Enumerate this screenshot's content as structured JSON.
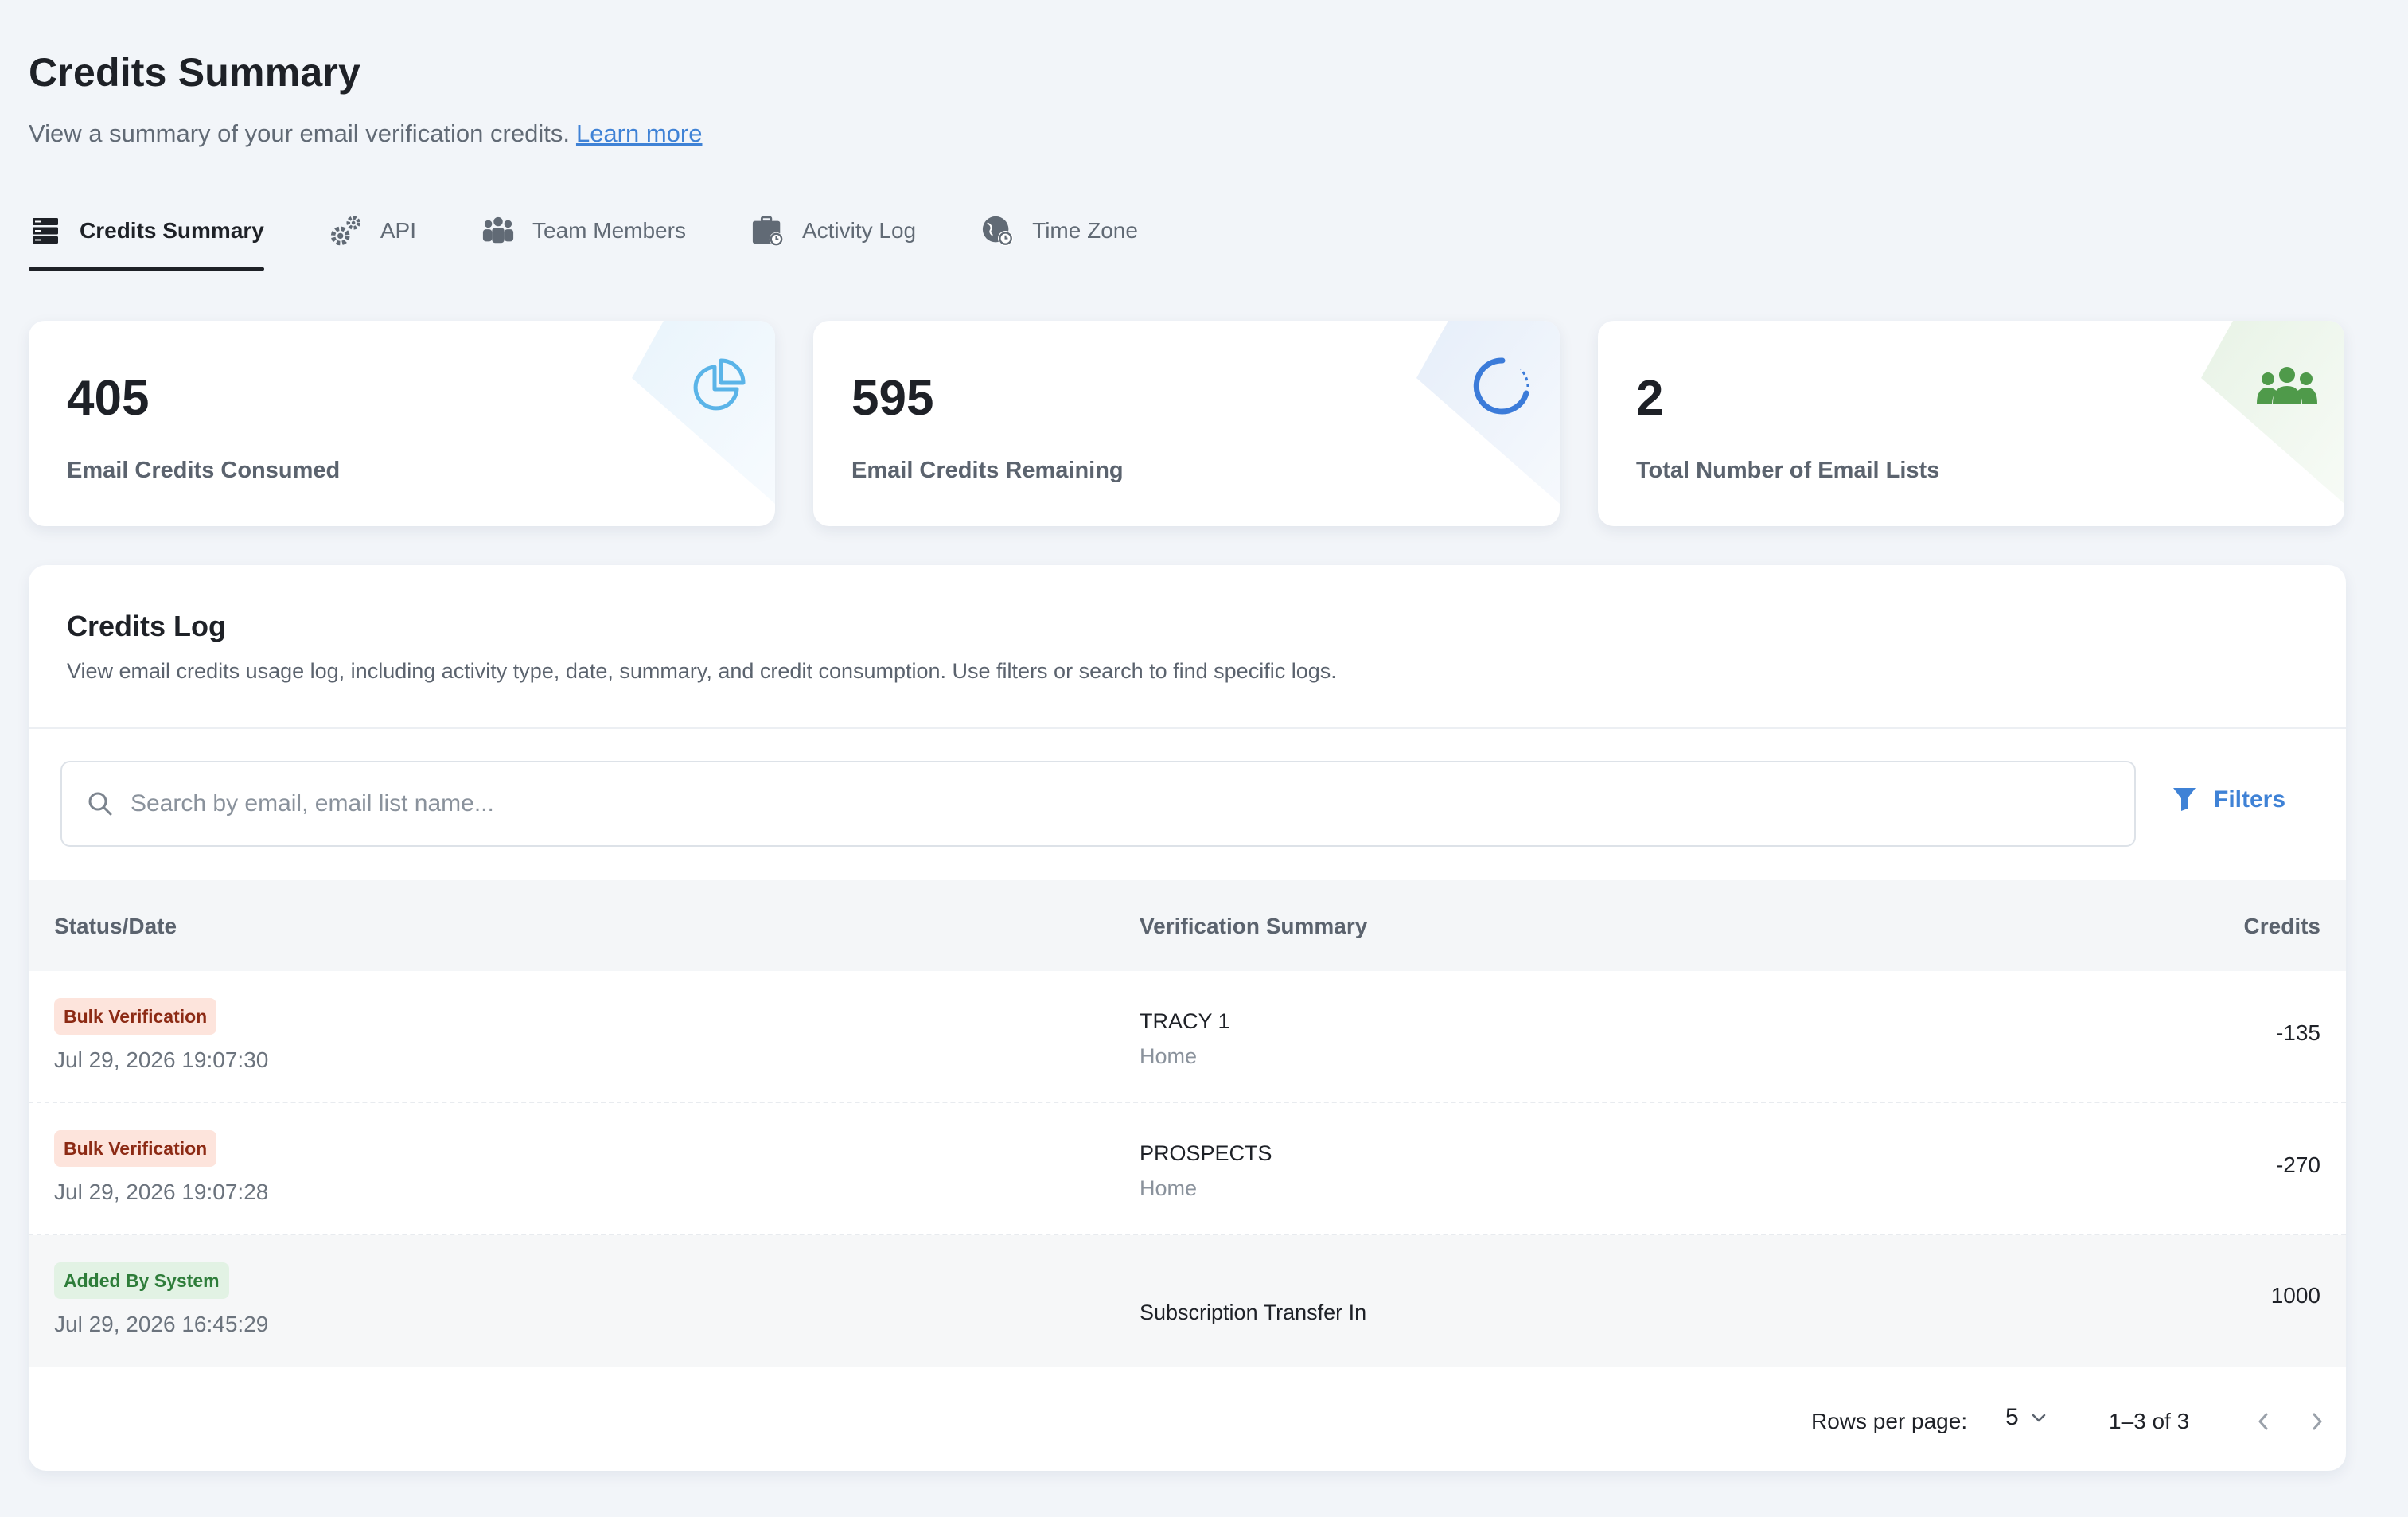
{
  "header": {
    "title": "Credits Summary",
    "subtitle": "View a summary of your email verification credits.",
    "learn_more": "Learn more"
  },
  "tabs": [
    {
      "label": "Credits Summary",
      "icon": "server-stack-icon",
      "active": true
    },
    {
      "label": "API",
      "icon": "gears-icon",
      "active": false
    },
    {
      "label": "Team Members",
      "icon": "people-group-icon",
      "active": false
    },
    {
      "label": "Activity Log",
      "icon": "briefcase-clock-icon",
      "active": false
    },
    {
      "label": "Time Zone",
      "icon": "globe-clock-icon",
      "active": false
    }
  ],
  "cards": [
    {
      "value": "405",
      "label": "Email Credits Consumed",
      "icon": "pie-chart-icon",
      "accent": "#5ab4e8"
    },
    {
      "value": "595",
      "label": "Email Credits Remaining",
      "icon": "circle-progress-icon",
      "accent": "#3b7bd9"
    },
    {
      "value": "2",
      "label": "Total Number of Email Lists",
      "icon": "users-icon",
      "accent": "#4f9a4a"
    }
  ],
  "credits_log": {
    "title": "Credits Log",
    "description": "View email credits usage log, including activity type, date, summary, and credit consumption. Use filters or search to find specific logs.",
    "search_placeholder": "Search by email, email list name...",
    "filters_label": "Filters",
    "columns": {
      "status": "Status/Date",
      "summary": "Verification Summary",
      "credits": "Credits"
    },
    "rows": [
      {
        "badge": "Bulk Verification",
        "badge_color": "red",
        "date": "Jul 29, 2026 19:07:30",
        "name": "TRACY 1",
        "sub": "Home",
        "credits": "-135"
      },
      {
        "badge": "Bulk Verification",
        "badge_color": "red",
        "date": "Jul 29, 2026 19:07:28",
        "name": "PROSPECTS",
        "sub": "Home",
        "credits": "-270"
      },
      {
        "badge": "Added By System",
        "badge_color": "green",
        "date": "Jul 29, 2026 16:45:29",
        "name": "Subscription Transfer In",
        "sub": "",
        "credits": "1000"
      }
    ],
    "pagination": {
      "rows_per_page_label": "Rows per page:",
      "rows_per_page": "5",
      "range": "1–3 of 3"
    }
  },
  "colors": {
    "accent": "#3f82d6",
    "background": "#f2f5f9",
    "badge_red_bg": "#fde4dc",
    "badge_green_bg": "#e2f2e4"
  }
}
